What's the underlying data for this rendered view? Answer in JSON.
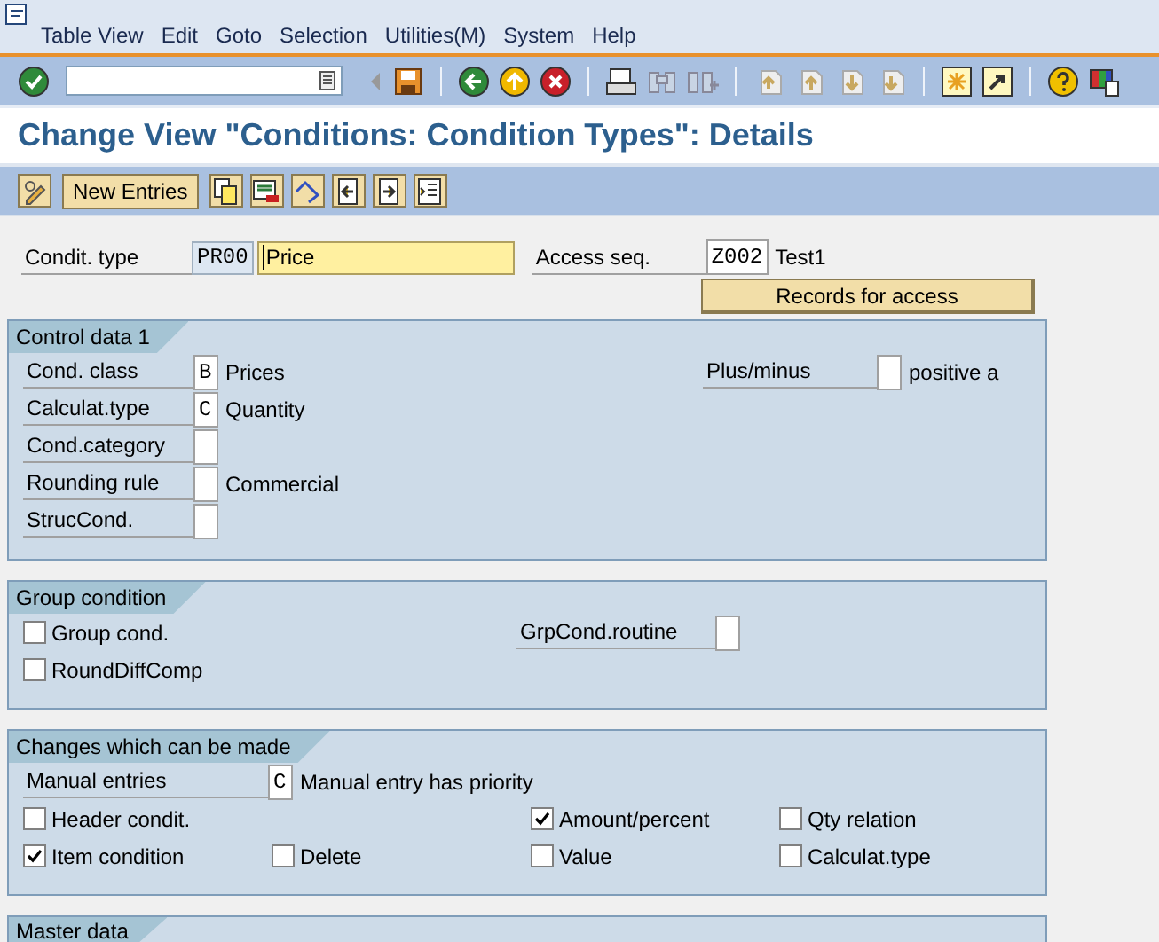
{
  "menu": [
    "Table View",
    "Edit",
    "Goto",
    "Selection",
    "Utilities(M)",
    "System",
    "Help"
  ],
  "title": "Change View \"Conditions: Condition Types\": Details",
  "app_toolbar": {
    "new_entries": "New Entries"
  },
  "header": {
    "condition_type": {
      "label": "Condit. type",
      "key": "PR00",
      "name": "Price"
    },
    "access_sequence": {
      "label": "Access seq.",
      "key": "Z002",
      "name": "Test1"
    },
    "records_button": "Records for access"
  },
  "groups": [
    {
      "title": "Control data 1",
      "kind": "form",
      "columns": [
        [
          {
            "kind": "field",
            "label": "Cond. class",
            "value": "B",
            "text": "Prices"
          },
          {
            "kind": "field",
            "label": "Calculat.type",
            "value": "C",
            "text": "Quantity"
          },
          {
            "kind": "field",
            "label": "Cond.category"
          },
          {
            "kind": "field",
            "label": "Rounding rule",
            "text": "Commercial"
          },
          {
            "kind": "field",
            "label": "StrucCond."
          }
        ],
        [
          {
            "kind": "field",
            "label": "Plus/minus",
            "text": "positive a"
          }
        ]
      ]
    },
    {
      "title": "Group condition",
      "kind": "form",
      "columns": [
        [
          {
            "kind": "checkbox",
            "label": "Group cond.",
            "checked": false
          },
          {
            "kind": "checkbox",
            "label": "RoundDiffComp",
            "checked": false
          }
        ],
        [
          {
            "kind": "field",
            "label": "GrpCond.routine"
          }
        ]
      ]
    },
    {
      "title": "Changes which can be made",
      "kind": "checks",
      "fields": [
        {
          "kind": "field",
          "label": "Manual entries",
          "value": "C",
          "text": "Manual entry has priority"
        }
      ],
      "columns": [
        [
          {
            "kind": "checkbox",
            "label": "Header condit.",
            "checked": false
          },
          {
            "kind": "checkbox",
            "label": "Item condition",
            "checked": true
          }
        ],
        [
          {
            "kind": "checkbox",
            "label": "Delete",
            "checked": false
          }
        ],
        [
          {
            "kind": "checkbox",
            "label": "Amount/percent",
            "checked": true
          },
          {
            "kind": "checkbox",
            "label": "Value",
            "checked": false
          }
        ],
        [
          {
            "kind": "checkbox",
            "label": "Qty relation",
            "checked": false
          },
          {
            "kind": "checkbox",
            "label": "Calculat.type",
            "checked": false
          }
        ]
      ]
    },
    {
      "title": "Master data"
    }
  ]
}
